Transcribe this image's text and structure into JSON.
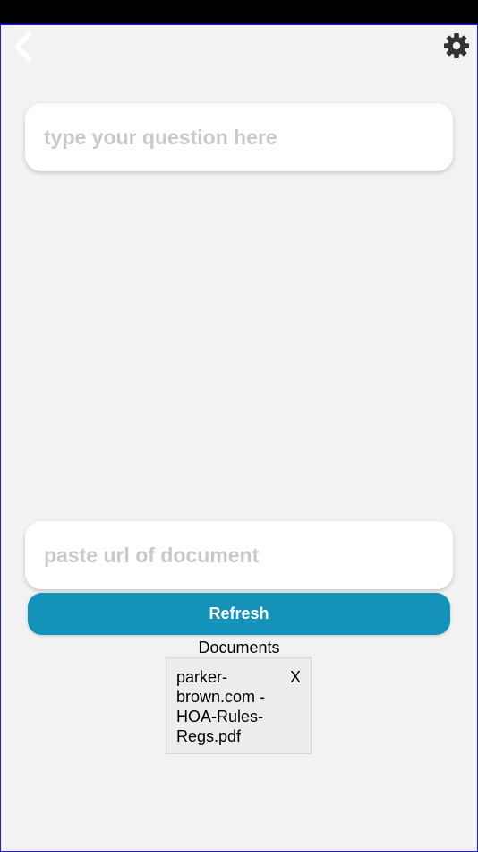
{
  "nav": {
    "back_icon": "chevron-left-icon",
    "settings_icon": "gear-icon"
  },
  "question": {
    "placeholder": "type your question here",
    "value": ""
  },
  "document_url": {
    "placeholder": "paste url of document",
    "value": ""
  },
  "refresh_label": "Refresh",
  "documents": {
    "heading": "Documents",
    "items": [
      {
        "name": "parker-\nbrown.com -\nHOA-Rules-\nRegs.pdf",
        "remove_label": "X"
      }
    ]
  },
  "colors": {
    "accent": "#1392ba",
    "background": "#f2f2f2",
    "placeholder": "#c9c9c9",
    "frame_border": "#1a1aff"
  }
}
